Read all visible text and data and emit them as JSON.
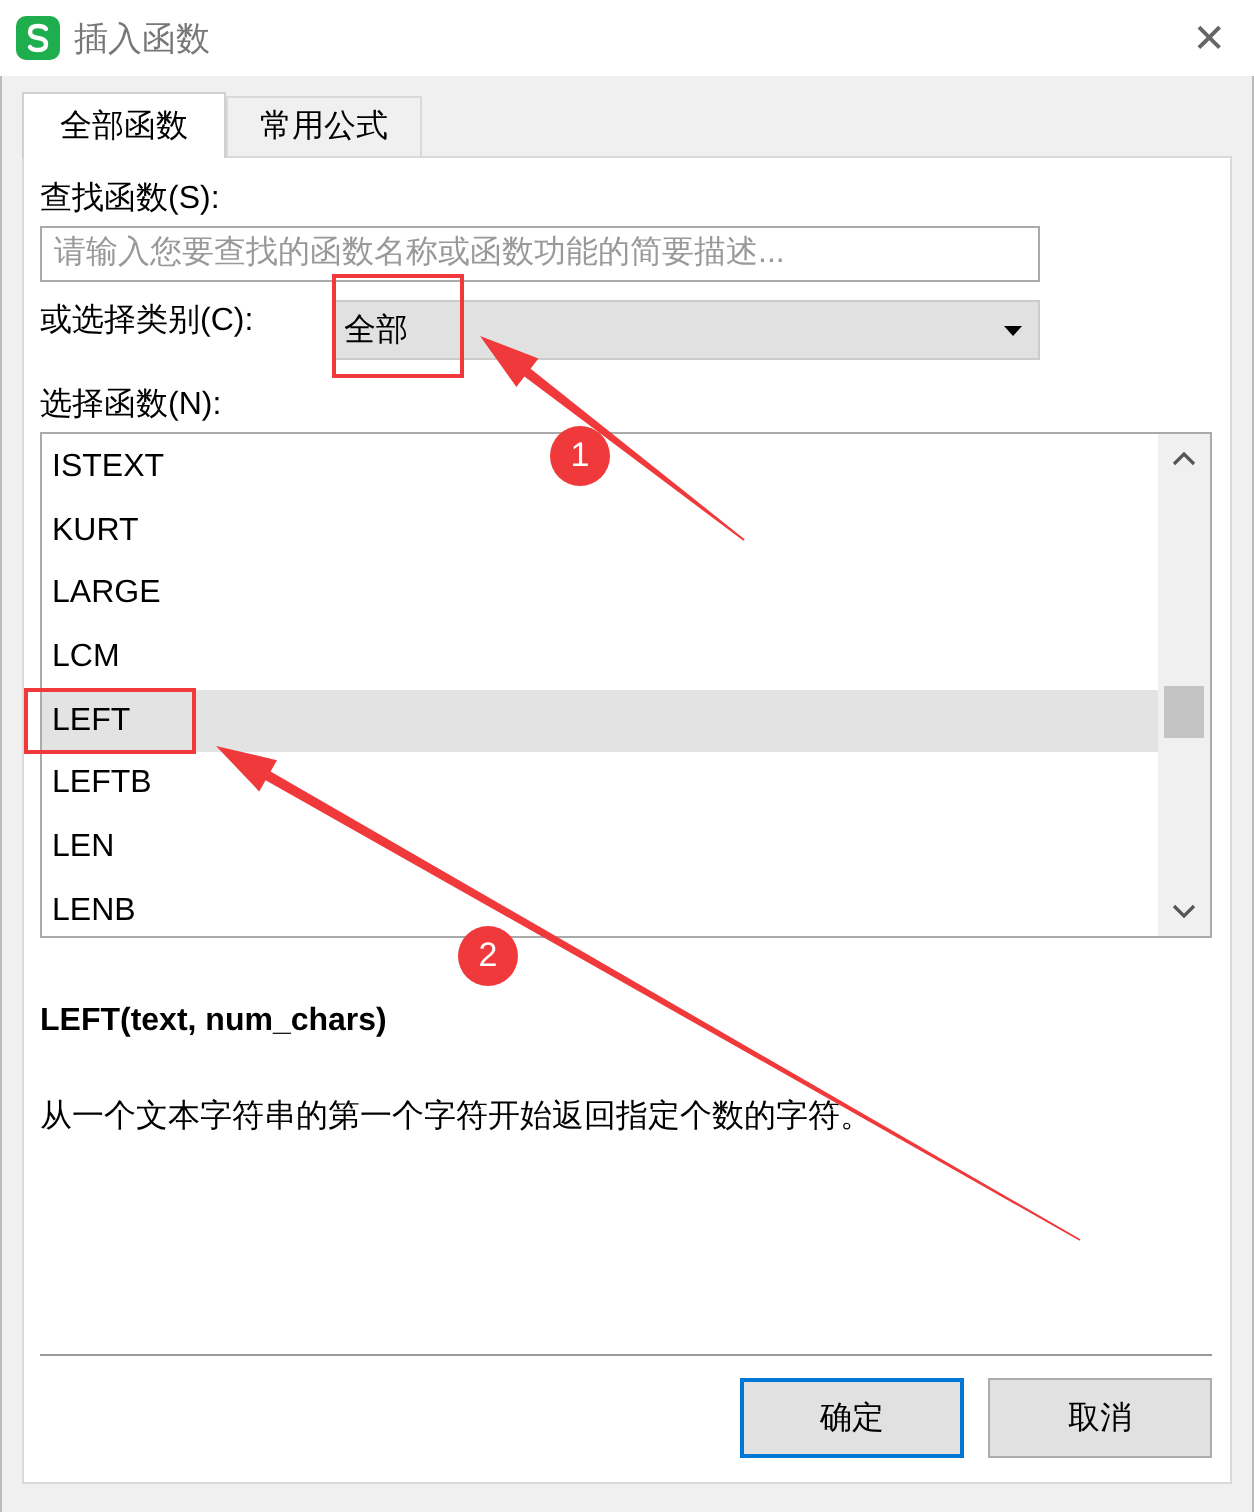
{
  "window": {
    "title": "插入函数",
    "close": "✕"
  },
  "tabs": [
    {
      "label": "全部函数",
      "selected": true
    },
    {
      "label": "常用公式",
      "selected": false
    }
  ],
  "search": {
    "label": "查找函数(S):",
    "placeholder": "请输入您要查找的函数名称或函数功能的简要描述..."
  },
  "category": {
    "label": "或选择类别(C):",
    "value": "全部"
  },
  "functions": {
    "label": "选择函数(N):",
    "items": [
      {
        "name": "ISTEXT",
        "selected": false
      },
      {
        "name": "KURT",
        "selected": false
      },
      {
        "name": "LARGE",
        "selected": false
      },
      {
        "name": "LCM",
        "selected": false
      },
      {
        "name": "LEFT",
        "selected": true
      },
      {
        "name": "LEFTB",
        "selected": false
      },
      {
        "name": "LEN",
        "selected": false
      },
      {
        "name": "LENB",
        "selected": false
      }
    ]
  },
  "signature": "LEFT(text, num_chars)",
  "description": "从一个文本字符串的第一个字符开始返回指定个数的字符。",
  "buttons": [
    {
      "label": "确定",
      "kind": "default"
    },
    {
      "label": "取消",
      "kind": "normal"
    }
  ],
  "annotations": [
    {
      "number": "1"
    },
    {
      "number": "2"
    }
  ]
}
